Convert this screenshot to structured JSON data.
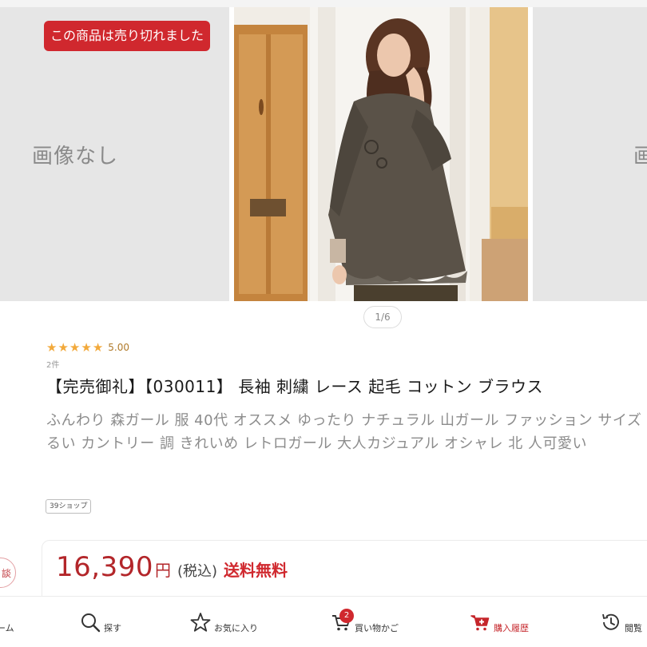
{
  "carousel": {
    "no_image_label": "画像なし",
    "no_image_label_right": "画",
    "soldout_label": "この商品は売り切れました",
    "pager": "1/6"
  },
  "product": {
    "rating": {
      "stars": 5,
      "value": "5.00",
      "review_count": "2件"
    },
    "title": "【完売御礼】【030011】 長袖 刺繍 レース 起毛 コットン ブラウス",
    "description": "ふんわり 森ガール 服 40代 オススメ ゆったり ナチュラル 山ガール ファッション サイズ ゆるい カントリー 調 きれいめ レトロガール 大人カジュアル オシャレ 北 人可愛い",
    "shop_tag": "39ショップ"
  },
  "price": {
    "amount": "16,390",
    "unit": "円",
    "tax": "(税込)",
    "shipping": "送料無料"
  },
  "side_badge": "談",
  "bottom_nav": {
    "home": "ーム",
    "search": "探す",
    "favorites": "お気に入り",
    "cart": "買い物かご",
    "cart_count": "2",
    "purchase_history": "購入履歴",
    "browsing_history": "閲覧"
  },
  "colors": {
    "accent_red": "#d0282e",
    "price_red": "#b3262a",
    "star_gold": "#f2a93b"
  }
}
